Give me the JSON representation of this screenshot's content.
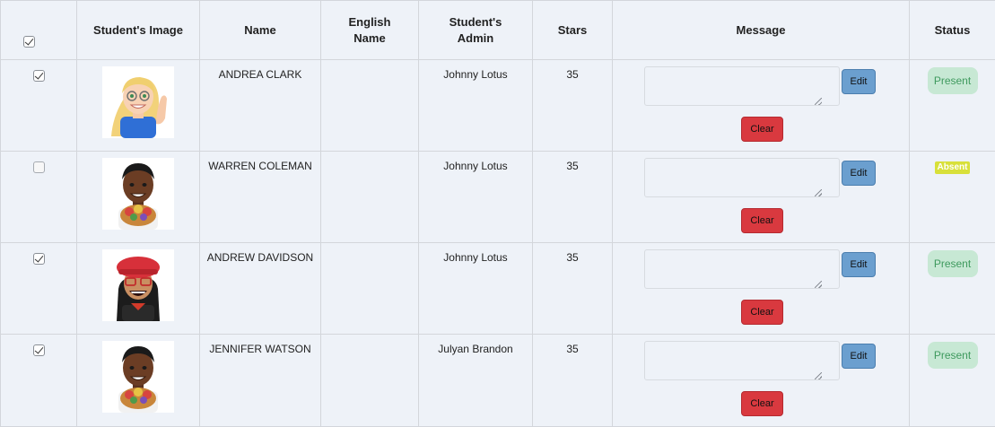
{
  "table": {
    "headers": {
      "image": "Student's Image",
      "name": "Name",
      "english_name_line1": "English",
      "english_name_line2": "Name",
      "admin_line1": "Student's",
      "admin_line2": "Admin",
      "stars": "Stars",
      "message": "Message",
      "status": "Status"
    },
    "select_all_checked": true,
    "edit_label": "Edit",
    "clear_label": "Clear",
    "rows": [
      {
        "checked": true,
        "name": "ANDREA CLARK",
        "english_name": "",
        "admin": "Johnny Lotus",
        "stars": "35",
        "message": "",
        "status": "Present",
        "avatar": "blonde-girl-waving-avatar"
      },
      {
        "checked": false,
        "name": "WARREN COLEMAN",
        "english_name": "",
        "admin": "Johnny Lotus",
        "stars": "35",
        "message": "",
        "status": "Absent",
        "avatar": "boy-with-flowers-avatar"
      },
      {
        "checked": true,
        "name": "ANDREW DAVIDSON",
        "english_name": "",
        "admin": "Johnny Lotus",
        "stars": "35",
        "message": "",
        "status": "Present",
        "avatar": "red-beret-glasses-avatar"
      },
      {
        "checked": true,
        "name": "JENNIFER WATSON",
        "english_name": "",
        "admin": "Julyan Brandon",
        "stars": "35",
        "message": "",
        "status": "Present",
        "avatar": "boy-with-flowers-avatar"
      }
    ]
  },
  "colors": {
    "background": "#eef2f8",
    "edit_button": "#6b9fcf",
    "clear_button": "#d9393f",
    "present_badge_bg": "#c7e8d4",
    "present_badge_text": "#3f9a5e",
    "absent_badge_bg": "#d8e03a"
  }
}
